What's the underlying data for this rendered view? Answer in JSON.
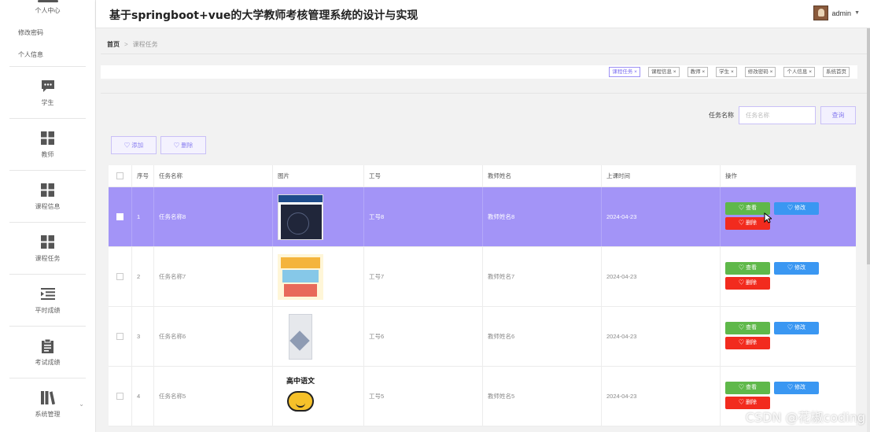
{
  "header": {
    "title": "基于springboot+vue的大学教师考核管理系统的设计与实现",
    "user": "admin"
  },
  "sidebar": {
    "top_item": "个人中心",
    "sub_items": [
      "修改密码",
      "个人信息"
    ],
    "menus": [
      {
        "label": "学生",
        "icon": "chat-icon"
      },
      {
        "label": "教师",
        "icon": "grid-icon"
      },
      {
        "label": "课程信息",
        "icon": "grid-icon"
      },
      {
        "label": "课程任务",
        "icon": "grid-icon"
      },
      {
        "label": "平时成绩",
        "icon": "list-indent-icon"
      },
      {
        "label": "考试成绩",
        "icon": "clipboard-icon"
      },
      {
        "label": "系统管理",
        "icon": "library-icon"
      }
    ]
  },
  "breadcrumb": {
    "home": "首页",
    "separator": ">",
    "current": "课程任务"
  },
  "tags": [
    "课程任务",
    "课程信息",
    "教师",
    "学生",
    "修改密码",
    "个人信息",
    "系统首页"
  ],
  "search": {
    "label": "任务名称",
    "placeholder": "任务名称",
    "button": "查询"
  },
  "actions": {
    "add": "添加",
    "delete": "删除"
  },
  "table": {
    "headers": [
      "序号",
      "任务名称",
      "图片",
      "工号",
      "教师姓名",
      "上课时间",
      "操作"
    ],
    "rows": [
      {
        "no": "1",
        "name": "任务名称8",
        "gh": "工号8",
        "teacher": "教师姓名8",
        "time": "2024-04-23"
      },
      {
        "no": "2",
        "name": "任务名称7",
        "gh": "工号7",
        "teacher": "教师姓名7",
        "time": "2024-04-23"
      },
      {
        "no": "3",
        "name": "任务名称6",
        "gh": "工号6",
        "teacher": "教师姓名6",
        "time": "2024-04-23"
      },
      {
        "no": "4",
        "name": "任务名称5",
        "gh": "工号5",
        "teacher": "教师姓名5",
        "time": "2024-04-23"
      }
    ],
    "op_view": "查看",
    "op_edit": "修改",
    "op_delete": "删除",
    "row4_image_text": "高中语文"
  },
  "colors": {
    "accent": "#a394f7",
    "view": "#5fb84a",
    "edit": "#3a97f2",
    "delete": "#f22b1e"
  },
  "watermark": "CSDN @花椒coding"
}
